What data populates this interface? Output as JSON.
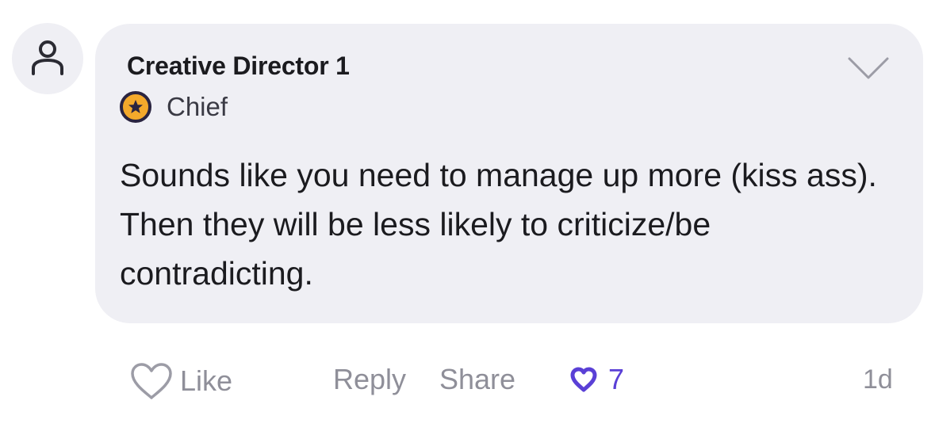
{
  "comment": {
    "author": "Creative Director 1",
    "badge": {
      "label": "Chief",
      "icon": "star-badge-icon",
      "color_ring": "#2a2440",
      "color_fill": "#f4a92b"
    },
    "body": "Sounds like you need to manage up more (kiss ass). Then they will be less likely to criticize/be contradicting.",
    "avatar_icon": "person-icon",
    "menu_icon": "chevron-down-icon"
  },
  "actions": {
    "like_label": "Like",
    "like_icon": "heart-outline-icon",
    "reply_label": "Reply",
    "share_label": "Share",
    "likes_count": "7",
    "likes_icon": "heart-filled-icon",
    "time_ago": "1d"
  },
  "colors": {
    "bubble_bg": "#efeff4",
    "muted_text": "#8f8f99",
    "accent": "#5a40d6"
  }
}
